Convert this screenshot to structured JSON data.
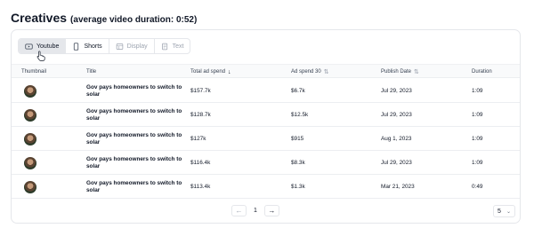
{
  "header": {
    "title": "Creatives",
    "subtitle": "(average video duration: 0:52)"
  },
  "tabs": [
    {
      "label": "Youtube",
      "icon": "youtube-icon",
      "state": "active"
    },
    {
      "label": "Shorts",
      "icon": "phone-icon",
      "state": "normal"
    },
    {
      "label": "Display",
      "icon": "display-icon",
      "state": "disabled"
    },
    {
      "label": "Text",
      "icon": "text-icon",
      "state": "disabled"
    }
  ],
  "table": {
    "columns": {
      "thumbnail": "Thumbnail",
      "title": "Title",
      "total_spend": "Total ad spend",
      "spend_30": "Ad spend 30",
      "publish_date": "Publish Date",
      "duration": "Duration"
    },
    "sort_column": "Total ad spend",
    "sort_direction": "descending",
    "rows": [
      {
        "title": "Gov pays homeowners to switch to solar",
        "total_spend": "$157.7k",
        "spend_30": "$6.7k",
        "publish_date": "Jul 29, 2023",
        "duration": "1:09"
      },
      {
        "title": "Gov pays homeowners to switch to solar",
        "total_spend": "$128.7k",
        "spend_30": "$12.5k",
        "publish_date": "Jul 29, 2023",
        "duration": "1:09"
      },
      {
        "title": "Gov pays homeowners to switch to solar",
        "total_spend": "$127k",
        "spend_30": "$915",
        "publish_date": "Aug 1, 2023",
        "duration": "1:09"
      },
      {
        "title": "Gov pays homeowners to switch to solar",
        "total_spend": "$116.4k",
        "spend_30": "$8.3k",
        "publish_date": "Jul 29, 2023",
        "duration": "1:09"
      },
      {
        "title": "Gov pays homeowners to switch to solar",
        "total_spend": "$113.4k",
        "spend_30": "$1.3k",
        "publish_date": "Mar 21, 2023",
        "duration": "0:49"
      }
    ]
  },
  "pagination": {
    "current_page": "1",
    "prev_icon": "arrow-left-icon",
    "next_icon": "arrow-right-icon",
    "page_size": "5"
  },
  "colors": {
    "active_tab_bg": "#e5e7eb",
    "border": "#e5e7eb",
    "header_bg": "#f9fafb",
    "muted_text": "#9ca3af"
  }
}
